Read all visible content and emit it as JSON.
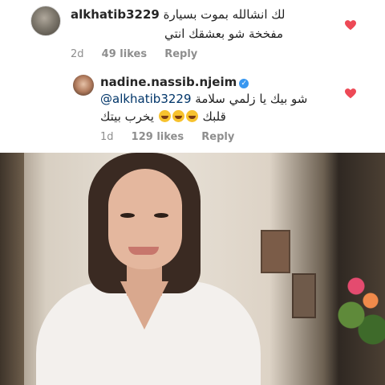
{
  "comments": [
    {
      "username": "alkhatib3229",
      "text_line1": "لك انشالله بموت بسيارة",
      "text_line2": "مفخخة شو بعشقك انتي",
      "time": "2d",
      "likes": "49 likes",
      "reply": "Reply",
      "liked": true,
      "heart_color": "#ed4956"
    },
    {
      "username": "nadine.nassib.njeim",
      "verified": true,
      "mention": "@alkhatib3229",
      "text_line1_rest": "شو بيك يا زلمي سلامة",
      "text_line2": "قلبك",
      "text_line2_rest": "يخرب بيتك",
      "emoji": "face-with-tears-of-joy",
      "time": "1d",
      "likes": "129 likes",
      "reply": "Reply",
      "liked": true,
      "heart_color": "#ed4956"
    }
  ],
  "photo": {
    "subject": "woman with bob haircut in white v-neck shirt smiling"
  }
}
